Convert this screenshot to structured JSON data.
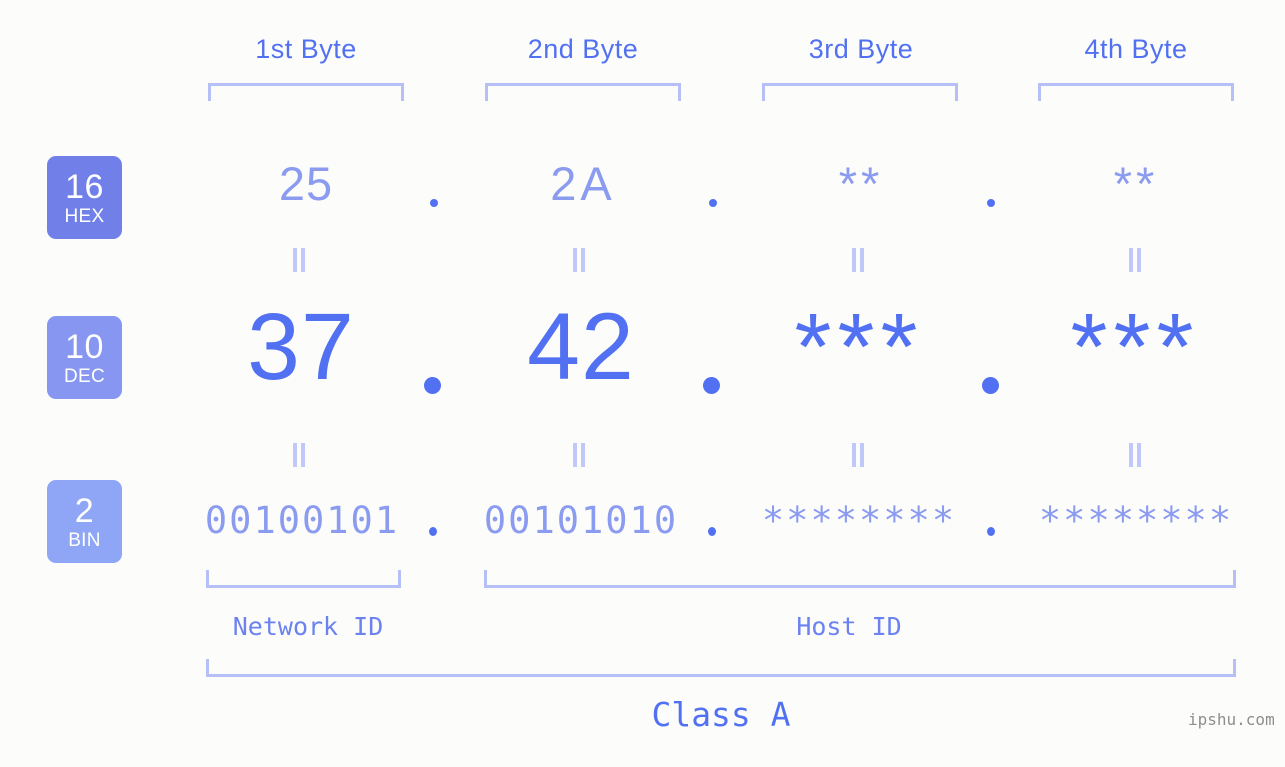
{
  "meta": {
    "background": "#fcfdfa",
    "accent": "#5271f2",
    "accent_light": "#8b9bf0",
    "bracket": "#b6c0f7",
    "watermark": "ipshu.com"
  },
  "byte_headers": [
    {
      "label": "1st Byte"
    },
    {
      "label": "2nd Byte"
    },
    {
      "label": "3rd Byte"
    },
    {
      "label": "4th Byte"
    }
  ],
  "bases": [
    {
      "num": "16",
      "abbr": "HEX",
      "color": "#7080e8"
    },
    {
      "num": "10",
      "abbr": "DEC",
      "color": "#8797f1"
    },
    {
      "num": "2",
      "abbr": "BIN",
      "color": "#8ea6f5"
    }
  ],
  "rows": {
    "hex": {
      "values": [
        "25",
        "2A",
        "**",
        "**"
      ],
      "separator": "."
    },
    "dec": {
      "values": [
        "37",
        "42",
        "***",
        "***"
      ],
      "separator": "."
    },
    "bin": {
      "values": [
        "00100101",
        "00101010",
        "********",
        "********"
      ],
      "separator": "."
    }
  },
  "equality_symbol": "=",
  "segments": [
    {
      "label": "Network ID"
    },
    {
      "label": "Host ID"
    }
  ],
  "class": {
    "label": "Class A"
  }
}
